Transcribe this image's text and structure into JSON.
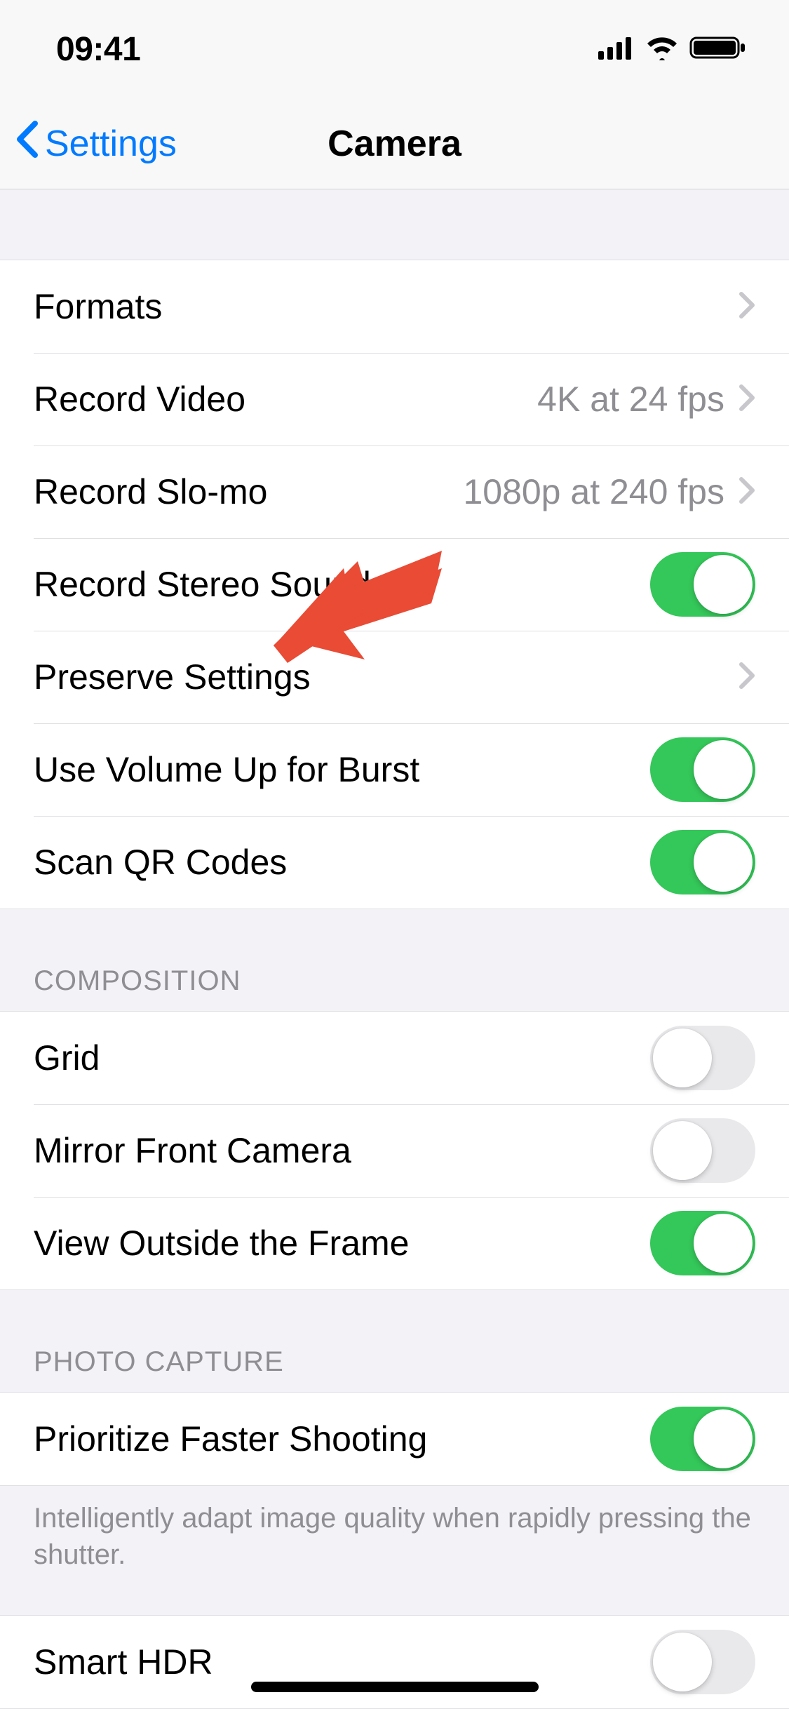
{
  "status": {
    "time": "09:41"
  },
  "nav": {
    "back_label": "Settings",
    "title": "Camera"
  },
  "group1": {
    "formats": "Formats",
    "record_video": "Record Video",
    "record_video_value": "4K at 24 fps",
    "record_slomo": "Record Slo-mo",
    "record_slomo_value": "1080p at 240 fps",
    "record_stereo": "Record Stereo Sound",
    "preserve_settings": "Preserve Settings",
    "volume_burst": "Use Volume Up for Burst",
    "scan_qr": "Scan QR Codes"
  },
  "group2": {
    "header": "COMPOSITION",
    "grid": "Grid",
    "mirror": "Mirror Front Camera",
    "outside_frame": "View Outside the Frame"
  },
  "group3": {
    "header": "PHOTO CAPTURE",
    "prioritize": "Prioritize Faster Shooting",
    "footer": "Intelligently adapt image quality when rapidly pressing the shutter.",
    "smart_hdr": "Smart HDR"
  }
}
